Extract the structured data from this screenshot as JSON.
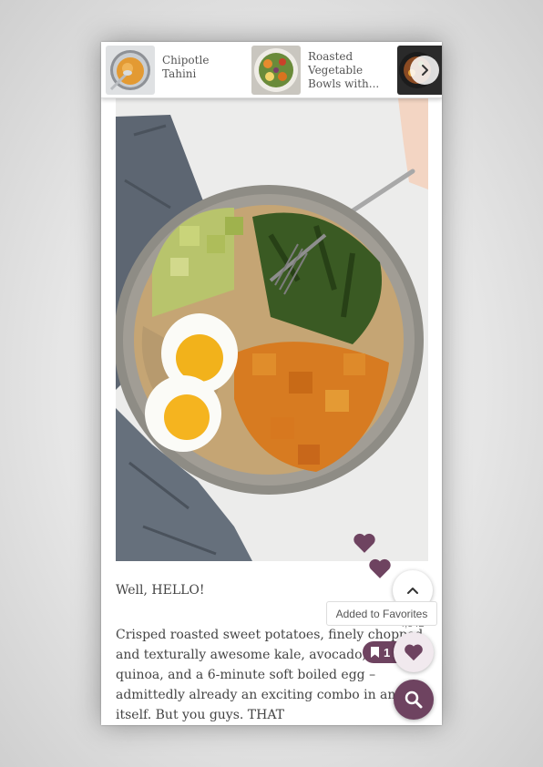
{
  "carousel": {
    "items": [
      {
        "title": "Chipotle Tahini",
        "thumb_icon": "sauce-bowl-thumbnail"
      },
      {
        "title": "Roasted Vegetable Bowls with...",
        "thumb_icon": "veggie-bowl-thumbnail"
      },
      {
        "title": "",
        "thumb_icon": "bowl-thumbnail"
      }
    ],
    "next_icon": "chevron-right-icon"
  },
  "hero": {
    "icon": "food-bowl-photo"
  },
  "article": {
    "greeting": "Well, HELLO!",
    "body": "Crisped roasted sweet potatoes, finely chopped and texturally awesome kale, avocado, hearty quinoa, and a 6-minute soft boiled egg – admittedly already an exciting combo in and of itself. But you guys. THAT"
  },
  "favorites": {
    "tooltip": "Added to Favorites",
    "count_peek": "4,342",
    "count": "1"
  },
  "colors": {
    "accent": "#6e4360",
    "fav_bg": "#f1e9ee"
  }
}
